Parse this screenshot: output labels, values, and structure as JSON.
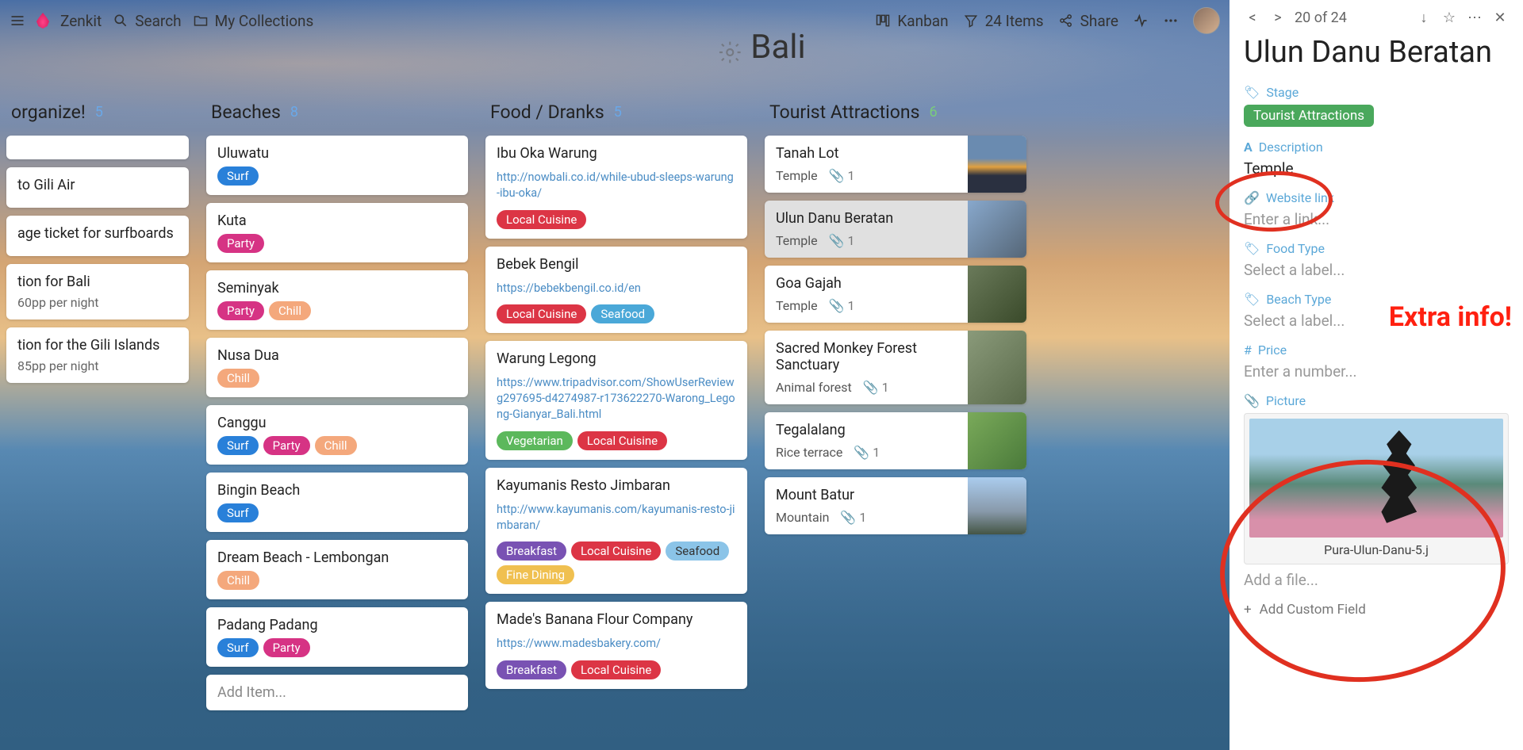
{
  "brand": "Zenkit",
  "search_label": "Search",
  "collections_label": "My Collections",
  "view_label": "Kanban",
  "filter_label": "24 Items",
  "share_label": "Share",
  "board_title": "Bali",
  "panel_counter": "20 of 24",
  "annotation": "Extra info!",
  "columns": [
    {
      "title": "organize!",
      "count": "5",
      "count_color": "#6aa8e8",
      "cards": [
        {
          "title": ""
        },
        {
          "title": "to Gili Air"
        },
        {
          "title": "age ticket for surfboards"
        },
        {
          "title": "tion for Bali",
          "sub": "60pp per night"
        },
        {
          "title": "tion for the Gili Islands",
          "sub": "85pp per night"
        }
      ]
    },
    {
      "title": "Beaches",
      "count": "8",
      "count_color": "#6aa8e8",
      "cards": [
        {
          "title": "Uluwatu",
          "tags": [
            {
              "t": "Surf",
              "c": "tag-blue"
            }
          ]
        },
        {
          "title": "Kuta",
          "tags": [
            {
              "t": "Party",
              "c": "tag-magenta"
            }
          ]
        },
        {
          "title": "Seminyak",
          "tags": [
            {
              "t": "Party",
              "c": "tag-magenta"
            },
            {
              "t": "Chill",
              "c": "tag-peach"
            }
          ]
        },
        {
          "title": "Nusa Dua",
          "tags": [
            {
              "t": "Chill",
              "c": "tag-peach"
            }
          ]
        },
        {
          "title": "Canggu",
          "tags": [
            {
              "t": "Surf",
              "c": "tag-blue"
            },
            {
              "t": "Party",
              "c": "tag-magenta"
            },
            {
              "t": "Chill",
              "c": "tag-peach"
            }
          ]
        },
        {
          "title": "Bingin Beach",
          "tags": [
            {
              "t": "Surf",
              "c": "tag-blue"
            }
          ]
        },
        {
          "title": "Dream Beach - Lembongan",
          "tags": [
            {
              "t": "Chill",
              "c": "tag-peach"
            }
          ]
        },
        {
          "title": "Padang Padang",
          "tags": [
            {
              "t": "Surf",
              "c": "tag-blue"
            },
            {
              "t": "Party",
              "c": "tag-magenta"
            }
          ]
        }
      ],
      "add": "Add Item..."
    },
    {
      "title": "Food / Dranks",
      "count": "5",
      "count_color": "#6aa8e8",
      "cards": [
        {
          "title": "Ibu Oka Warung",
          "link": "http://nowbali.co.id/while-ubud-sleeps-warung-ibu-oka/",
          "tags": [
            {
              "t": "Local Cuisine",
              "c": "tag-red"
            }
          ]
        },
        {
          "title": "Bebek Bengil",
          "link": "https://bebekbengil.co.id/en",
          "tags": [
            {
              "t": "Local Cuisine",
              "c": "tag-red"
            },
            {
              "t": "Seafood",
              "c": "tag-teal"
            }
          ]
        },
        {
          "title": "Warung Legong",
          "link": "https://www.tripadvisor.com/ShowUserReviewg297695-d4274987-r173622270-Warong_Legong-Gianyar_Bali.html",
          "tags": [
            {
              "t": "Vegetarian",
              "c": "tag-green"
            },
            {
              "t": "Local Cuisine",
              "c": "tag-red"
            }
          ]
        },
        {
          "title": "Kayumanis Resto Jimbaran",
          "link": "http://www.kayumanis.com/kayumanis-resto-jimbaran/",
          "tags": [
            {
              "t": "Breakfast",
              "c": "tag-purple"
            },
            {
              "t": "Local Cuisine",
              "c": "tag-red"
            },
            {
              "t": "Seafood",
              "c": "tag-cyan"
            },
            {
              "t": "Fine Dining",
              "c": "tag-yellow"
            }
          ]
        },
        {
          "title": "Made's Banana Flour Company",
          "link": "https://www.madesbakery.com/",
          "tags": [
            {
              "t": "Breakfast",
              "c": "tag-purple"
            },
            {
              "t": "Local Cuisine",
              "c": "tag-red"
            }
          ]
        }
      ]
    },
    {
      "title": "Tourist Attractions",
      "count": "6",
      "count_color": "#7acc7a",
      "cards": [
        {
          "title": "Tanah Lot",
          "desc": "Temple",
          "att": "1",
          "thumb": "t1"
        },
        {
          "title": "Ulun Danu Beratan",
          "desc": "Temple",
          "att": "1",
          "thumb": "t2",
          "selected": true
        },
        {
          "title": "Goa Gajah",
          "desc": "Temple",
          "att": "1",
          "thumb": "t3"
        },
        {
          "title": "Sacred Monkey Forest Sanctuary",
          "desc": "Animal forest",
          "att": "1",
          "thumb": "t4"
        },
        {
          "title": "Tegalalang",
          "desc": "Rice terrace",
          "att": "1",
          "thumb": "t5"
        },
        {
          "title": "Mount Batur",
          "desc": "Mountain",
          "att": "1",
          "thumb": "t6"
        }
      ]
    }
  ],
  "panel": {
    "title": "Ulun Danu Beratan",
    "fields": {
      "stage": {
        "label": "Stage",
        "value": "Tourist Attractions"
      },
      "description": {
        "label": "Description",
        "value": "Temple"
      },
      "website": {
        "label": "Website link",
        "placeholder": "Enter a link..."
      },
      "foodtype": {
        "label": "Food Type",
        "placeholder": "Select a label..."
      },
      "beachtype": {
        "label": "Beach Type",
        "placeholder": "Select a label..."
      },
      "price": {
        "label": "Price",
        "placeholder": "Enter a number..."
      },
      "picture": {
        "label": "Picture",
        "filename": "Pura-Ulun-Danu-5.j",
        "addfile": "Add a file..."
      }
    },
    "add_custom": "Add Custom Field"
  }
}
